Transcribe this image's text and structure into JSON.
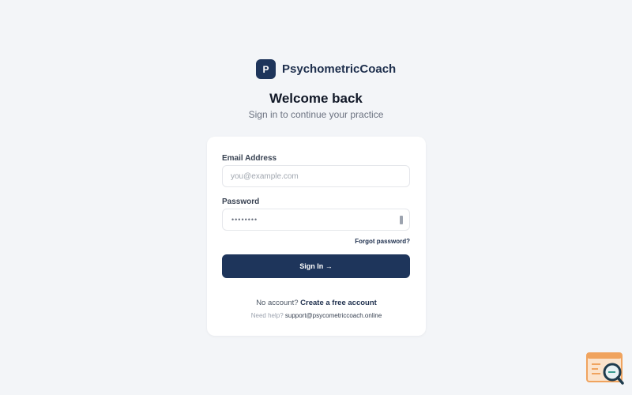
{
  "brand": {
    "logo_letter": "P",
    "name": "PsychometricCoach"
  },
  "heading": "Welcome back",
  "subheading": "Sign in to continue your practice",
  "form": {
    "email_label": "Email Address",
    "email_placeholder": "you@example.com",
    "password_label": "Password",
    "password_masked": "••••••••",
    "forgot_label": "Forgot password?",
    "submit_label": "Sign In →"
  },
  "footer": {
    "no_account_text": "No account?",
    "create_account_label": "Create a free account",
    "help_text": "Need help?",
    "support_email": "support@psycometriccoach.online"
  },
  "colors": {
    "primary": "#1e355b",
    "background": "#f3f5f8",
    "card": "#ffffff",
    "widget_accent": "#f0a35e",
    "widget_dark": "#1f3b4d"
  },
  "icons": {
    "password_toggle": "eye-icon",
    "corner_widget": "search-chart-icon"
  }
}
